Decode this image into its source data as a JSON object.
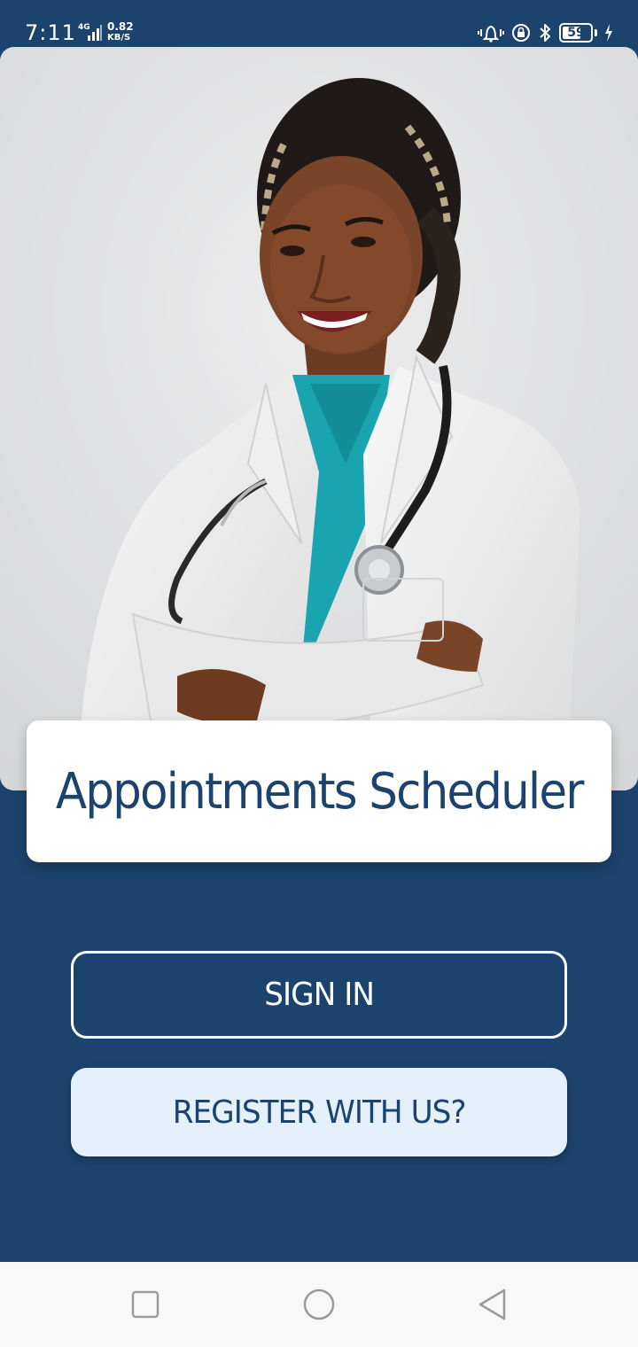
{
  "status_bar": {
    "time": "7:11",
    "network_type": "4G",
    "network_speed": "0.82",
    "network_speed_unit": "KB/S",
    "battery_level": "59",
    "icons": [
      "signal-icon",
      "vibrate-icon",
      "rotation-lock-icon",
      "bluetooth-icon",
      "battery-icon",
      "charging-icon"
    ]
  },
  "hero": {
    "image": "doctor-photo"
  },
  "app": {
    "title": "Appointments Scheduler"
  },
  "actions": {
    "sign_in_label": "SIGN IN",
    "register_label": "REGISTER WITH US?"
  },
  "navigation": {
    "buttons": [
      "recent-apps-icon",
      "home-icon",
      "back-icon"
    ]
  },
  "colors": {
    "primary": "#1c436d",
    "register_bg": "#e4f1fc",
    "card_bg": "#ffffff",
    "nav_bg": "#f8f8f8"
  }
}
